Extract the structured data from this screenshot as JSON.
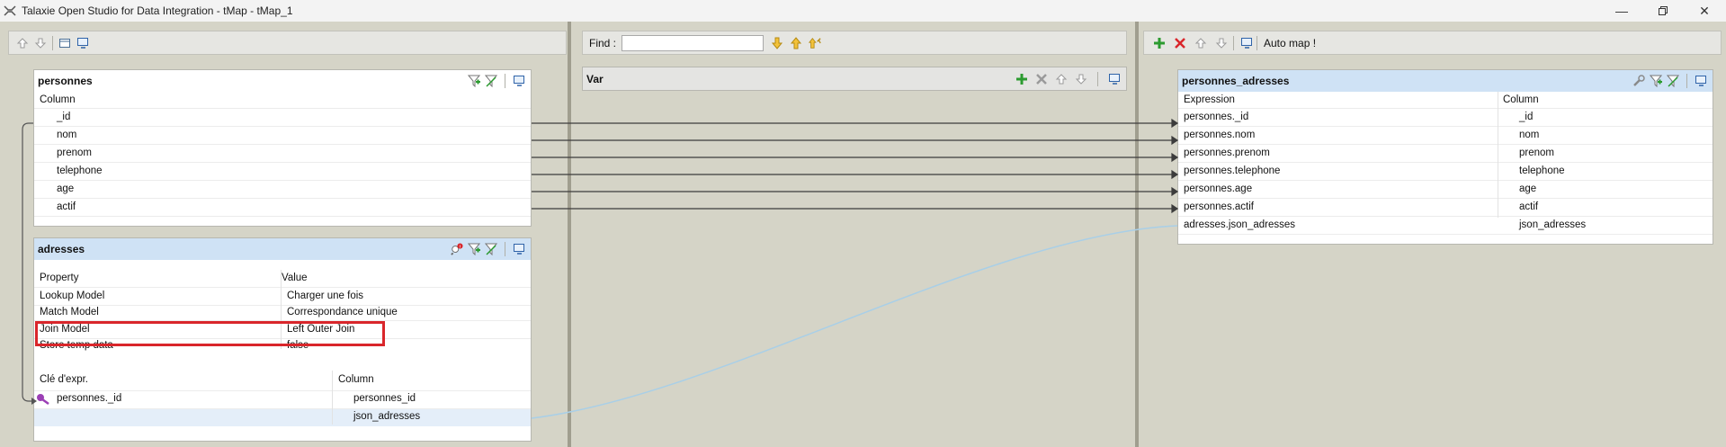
{
  "window": {
    "title": "Talaxie Open Studio for Data Integration - tMap - tMap_1"
  },
  "find": {
    "label": "Find :",
    "value": ""
  },
  "outputs_toolbar": {
    "auto_map_label": "Auto map !"
  },
  "input_personnes": {
    "name": "personnes",
    "column_header": "Column",
    "columns": [
      "_id",
      "nom",
      "prenom",
      "telephone",
      "age",
      "actif"
    ]
  },
  "lookup_adresses": {
    "name": "adresses",
    "property_header": "Property",
    "value_header": "Value",
    "properties": [
      {
        "property": "Lookup Model",
        "value": "Charger une fois"
      },
      {
        "property": "Match Model",
        "value": "Correspondance unique"
      },
      {
        "property": "Join Model",
        "value": "Left Outer Join"
      },
      {
        "property": "Store temp data",
        "value": "false"
      }
    ],
    "expr_key_header": "Clé d'expr.",
    "column_header": "Column",
    "rows": [
      {
        "expr": "personnes._id",
        "column": "personnes_id"
      },
      {
        "expr": "",
        "column": "json_adresses"
      }
    ]
  },
  "var_panel": {
    "name": "Var"
  },
  "output_personnes_adresses": {
    "name": "personnes_adresses",
    "expression_header": "Expression",
    "column_header": "Column",
    "rows": [
      {
        "expr": "personnes._id",
        "column": "_id"
      },
      {
        "expr": "personnes.nom",
        "column": "nom"
      },
      {
        "expr": "personnes.prenom",
        "column": "prenom"
      },
      {
        "expr": "personnes.telephone",
        "column": "telephone"
      },
      {
        "expr": "personnes.age",
        "column": "age"
      },
      {
        "expr": "personnes.actif",
        "column": "actif"
      },
      {
        "expr": "adresses.json_adresses",
        "column": "json_adresses"
      }
    ]
  },
  "colors": {
    "header_blue": "#cfe2f5",
    "highlight_red": "#d9262b",
    "link": "#3c3c3c",
    "lookup_link": "#a9cfe7",
    "background": "#d5d4c7"
  }
}
